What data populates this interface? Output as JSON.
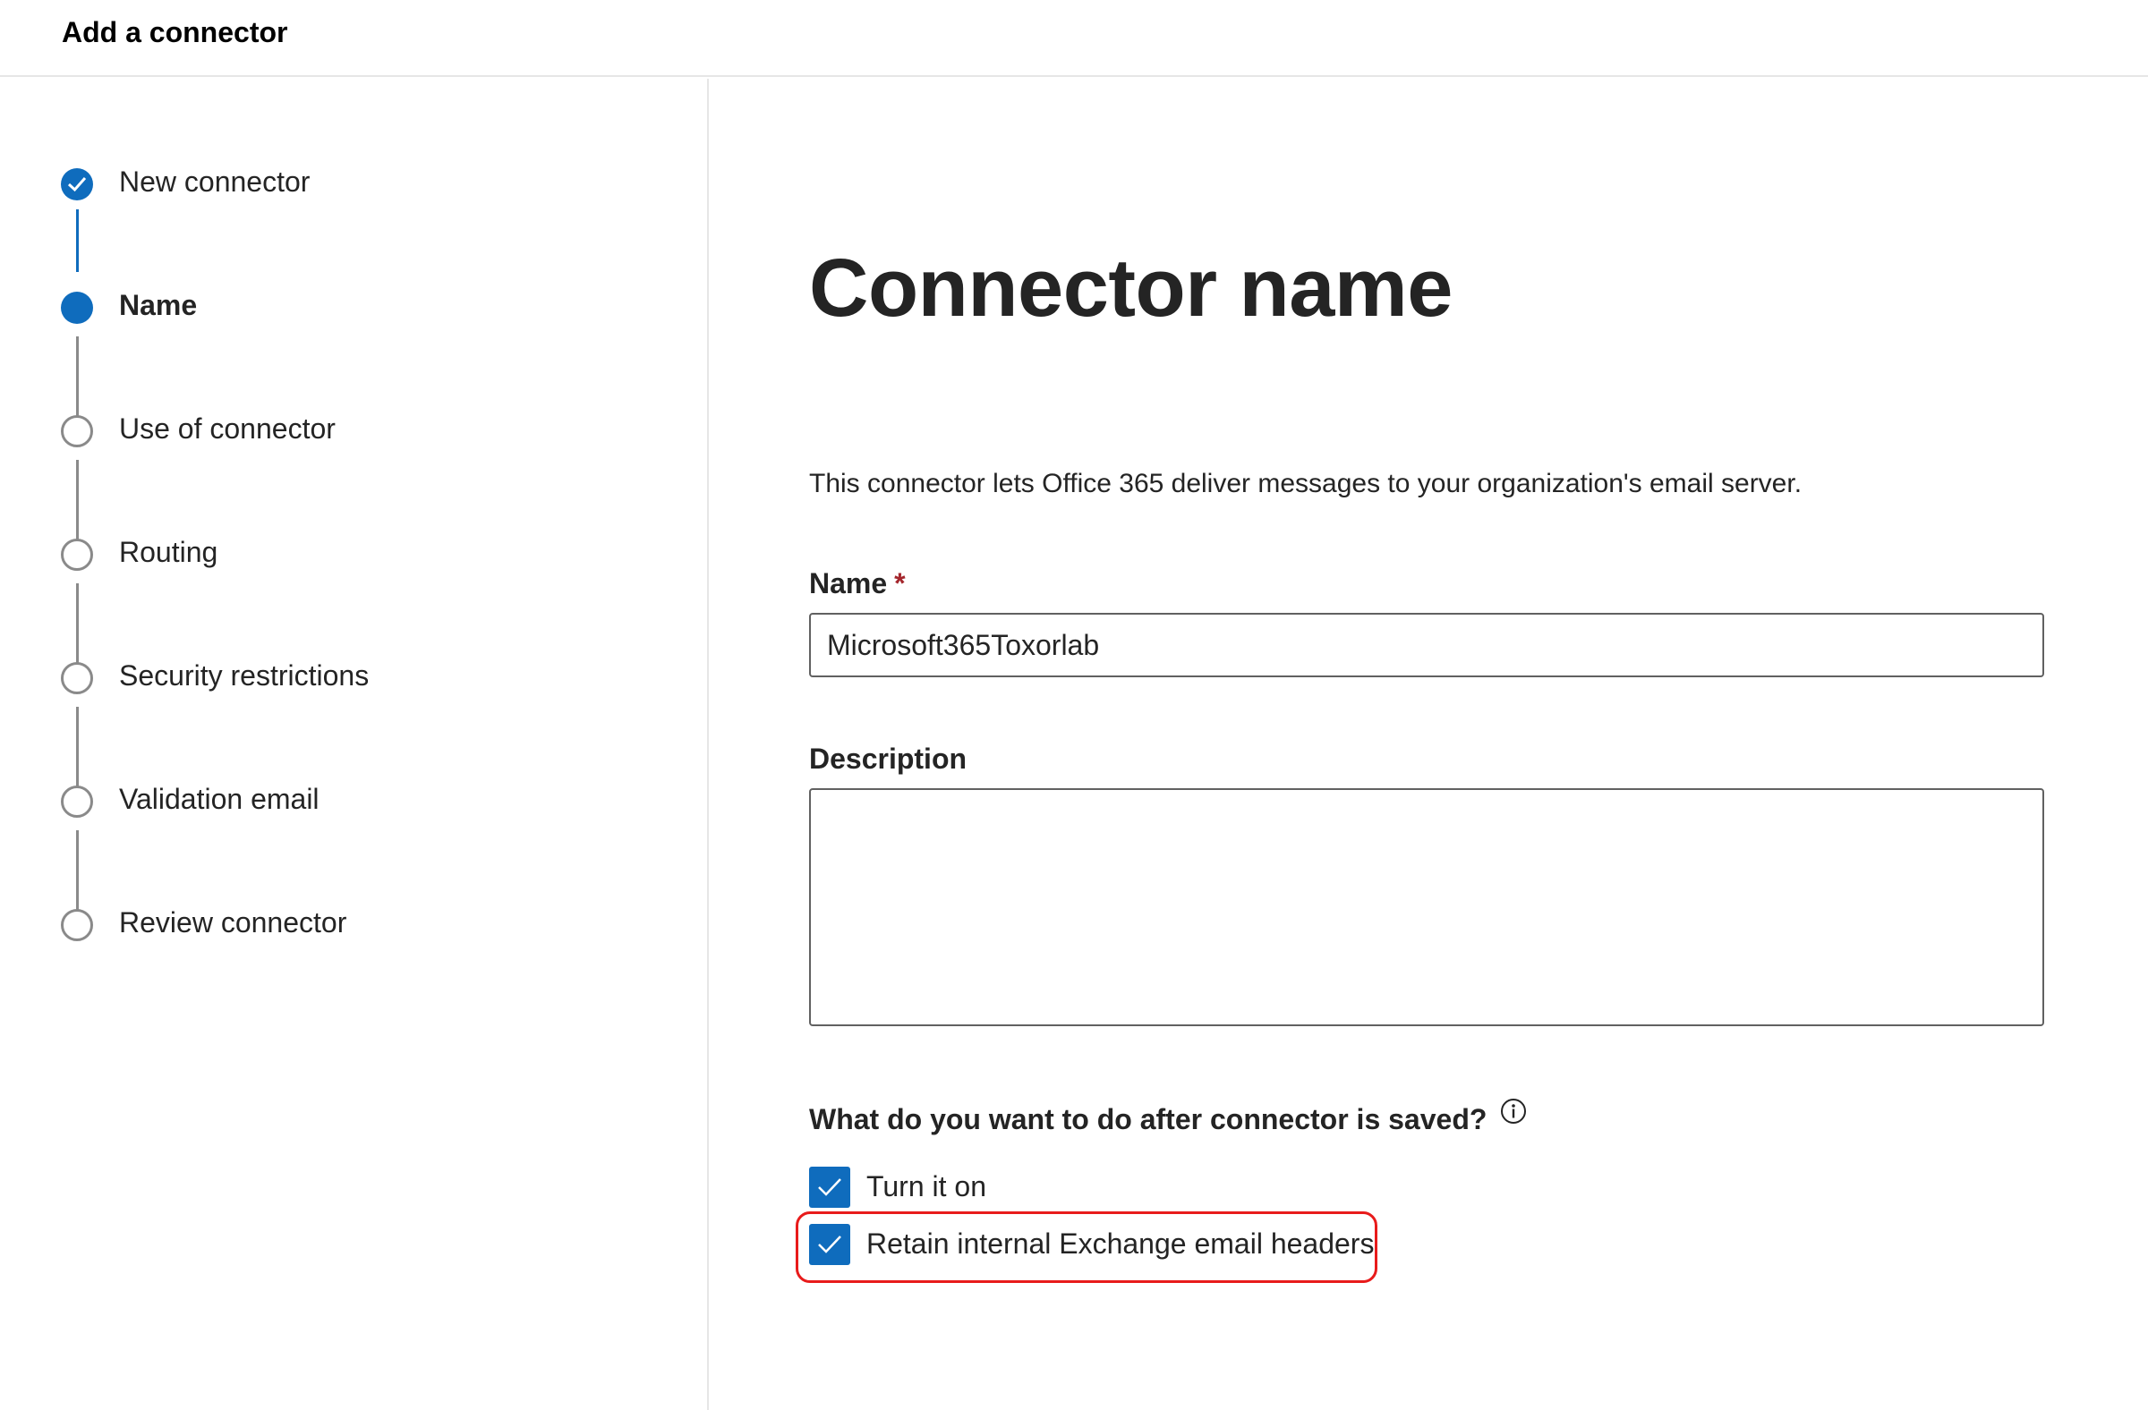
{
  "header": {
    "title": "Add a connector"
  },
  "steps": [
    {
      "label": "New connector",
      "state": "done"
    },
    {
      "label": "Name",
      "state": "current"
    },
    {
      "label": "Use of connector",
      "state": "todo"
    },
    {
      "label": "Routing",
      "state": "todo"
    },
    {
      "label": "Security restrictions",
      "state": "todo"
    },
    {
      "label": "Validation email",
      "state": "todo"
    },
    {
      "label": "Review connector",
      "state": "todo"
    }
  ],
  "main": {
    "heading": "Connector name",
    "intro": "This connector lets Office 365 deliver messages to your organization's email server.",
    "name_field": {
      "label": "Name",
      "required_mark": "*",
      "value": "Microsoft365Toxorlab"
    },
    "description_field": {
      "label": "Description",
      "value": ""
    },
    "after_save": {
      "question": "What do you want to do after connector is saved?",
      "options": [
        {
          "label": "Turn it on",
          "checked": true
        },
        {
          "label": "Retain internal Exchange email headers",
          "checked": true,
          "highlighted": true
        }
      ]
    }
  },
  "colors": {
    "accent": "#0f6cbd",
    "highlight": "#e81b1b",
    "pending": "#8a8a8a"
  }
}
